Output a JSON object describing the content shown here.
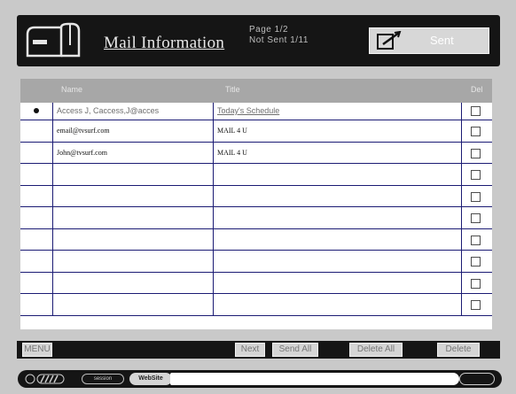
{
  "header": {
    "title": "Mail Information",
    "page_line1": "Page 1/2",
    "page_line2": "Not Sent 1/11",
    "sent_label": "Sent"
  },
  "table": {
    "columns": {
      "name": "Name",
      "title": "Title",
      "del": "Del"
    },
    "rows": [
      {
        "name": "Access J, Caccess,J@acces",
        "title": "Today's Schedule",
        "selected": true
      },
      {
        "name": "email@tvsurf.com",
        "title": "MAIL 4 U",
        "selected": false
      },
      {
        "name": "John@tvsurf.com",
        "title": "MAIL 4 U",
        "selected": false
      },
      {
        "name": "",
        "title": "",
        "selected": false
      },
      {
        "name": "",
        "title": "",
        "selected": false
      },
      {
        "name": "",
        "title": "",
        "selected": false
      },
      {
        "name": "",
        "title": "",
        "selected": false
      },
      {
        "name": "",
        "title": "",
        "selected": false
      },
      {
        "name": "",
        "title": "",
        "selected": false
      },
      {
        "name": "",
        "title": "",
        "selected": false
      }
    ]
  },
  "toolbar": {
    "menu": "MENU",
    "next": "Next",
    "send_all": "Send All",
    "delete_all": "Delete All",
    "delete": "Delete"
  },
  "statusbar": {
    "status_label": "session",
    "website_label": "WebSite",
    "url": ""
  },
  "colors": {
    "background": "#c9c9c9",
    "bar": "#151515",
    "grid_line": "#1b1b74",
    "header_row": "#a7a7a7"
  }
}
